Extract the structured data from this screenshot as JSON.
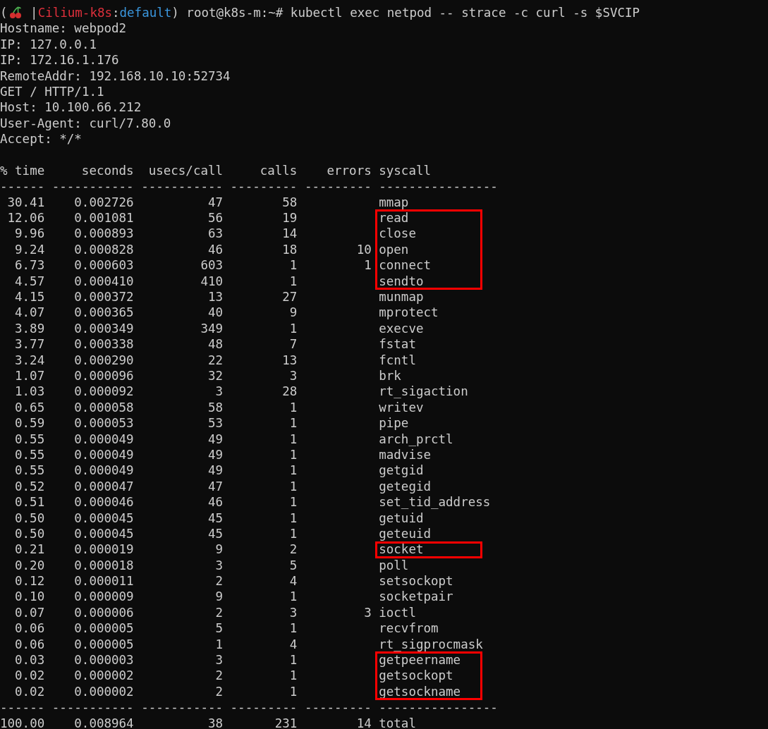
{
  "prompt": [
    {
      "kind": "plain",
      "text": "("
    },
    {
      "kind": "icon"
    },
    {
      "kind": "plain",
      "text": " |"
    },
    {
      "kind": "context",
      "text": "Cilium-k8s"
    },
    {
      "kind": "plain",
      "text": ":"
    },
    {
      "kind": "namespace",
      "text": "default"
    },
    {
      "kind": "plain",
      "text": ") root@k8s-m:~# kubectl exec netpod -- strace -c curl -s $SVCIP"
    }
  ],
  "output_lines": [
    "Hostname: webpod2",
    "IP: 127.0.0.1",
    "IP: 172.16.1.176",
    "RemoteAddr: 192.168.10.10:52734",
    "GET / HTTP/1.1",
    "Host: 10.100.66.212",
    "User-Agent: curl/7.80.0",
    "Accept: */*"
  ],
  "table": {
    "columns": [
      "% time",
      "seconds",
      "usecs/call",
      "calls",
      "errors",
      "syscall"
    ],
    "rule": [
      "------",
      "-----------",
      "-----------",
      "---------",
      "---------",
      "----------------"
    ],
    "rows": [
      {
        "cells": [
          "30.41",
          "0.002726",
          "47",
          "58",
          "",
          "mmap"
        ],
        "highlighted": false
      },
      {
        "cells": [
          "12.06",
          "0.001081",
          "56",
          "19",
          "",
          "read"
        ],
        "highlighted": true
      },
      {
        "cells": [
          "9.96",
          "0.000893",
          "63",
          "14",
          "",
          "close"
        ],
        "highlighted": true
      },
      {
        "cells": [
          "9.24",
          "0.000828",
          "46",
          "18",
          "10",
          "open"
        ],
        "highlighted": true
      },
      {
        "cells": [
          "6.73",
          "0.000603",
          "603",
          "1",
          "1",
          "connect"
        ],
        "highlighted": true
      },
      {
        "cells": [
          "4.57",
          "0.000410",
          "410",
          "1",
          "",
          "sendto"
        ],
        "highlighted": true
      },
      {
        "cells": [
          "4.15",
          "0.000372",
          "13",
          "27",
          "",
          "munmap"
        ],
        "highlighted": false
      },
      {
        "cells": [
          "4.07",
          "0.000365",
          "40",
          "9",
          "",
          "mprotect"
        ],
        "highlighted": false
      },
      {
        "cells": [
          "3.89",
          "0.000349",
          "349",
          "1",
          "",
          "execve"
        ],
        "highlighted": false
      },
      {
        "cells": [
          "3.77",
          "0.000338",
          "48",
          "7",
          "",
          "fstat"
        ],
        "highlighted": false
      },
      {
        "cells": [
          "3.24",
          "0.000290",
          "22",
          "13",
          "",
          "fcntl"
        ],
        "highlighted": false
      },
      {
        "cells": [
          "1.07",
          "0.000096",
          "32",
          "3",
          "",
          "brk"
        ],
        "highlighted": false
      },
      {
        "cells": [
          "1.03",
          "0.000092",
          "3",
          "28",
          "",
          "rt_sigaction"
        ],
        "highlighted": false
      },
      {
        "cells": [
          "0.65",
          "0.000058",
          "58",
          "1",
          "",
          "writev"
        ],
        "highlighted": false
      },
      {
        "cells": [
          "0.59",
          "0.000053",
          "53",
          "1",
          "",
          "pipe"
        ],
        "highlighted": false
      },
      {
        "cells": [
          "0.55",
          "0.000049",
          "49",
          "1",
          "",
          "arch_prctl"
        ],
        "highlighted": false
      },
      {
        "cells": [
          "0.55",
          "0.000049",
          "49",
          "1",
          "",
          "madvise"
        ],
        "highlighted": false
      },
      {
        "cells": [
          "0.55",
          "0.000049",
          "49",
          "1",
          "",
          "getgid"
        ],
        "highlighted": false
      },
      {
        "cells": [
          "0.52",
          "0.000047",
          "47",
          "1",
          "",
          "getegid"
        ],
        "highlighted": false
      },
      {
        "cells": [
          "0.51",
          "0.000046",
          "46",
          "1",
          "",
          "set_tid_address"
        ],
        "highlighted": false
      },
      {
        "cells": [
          "0.50",
          "0.000045",
          "45",
          "1",
          "",
          "getuid"
        ],
        "highlighted": false
      },
      {
        "cells": [
          "0.50",
          "0.000045",
          "45",
          "1",
          "",
          "geteuid"
        ],
        "highlighted": false
      },
      {
        "cells": [
          "0.21",
          "0.000019",
          "9",
          "2",
          "",
          "socket"
        ],
        "highlighted": true
      },
      {
        "cells": [
          "0.20",
          "0.000018",
          "3",
          "5",
          "",
          "poll"
        ],
        "highlighted": false
      },
      {
        "cells": [
          "0.12",
          "0.000011",
          "2",
          "4",
          "",
          "setsockopt"
        ],
        "highlighted": false
      },
      {
        "cells": [
          "0.10",
          "0.000009",
          "9",
          "1",
          "",
          "socketpair"
        ],
        "highlighted": false
      },
      {
        "cells": [
          "0.07",
          "0.000006",
          "2",
          "3",
          "3",
          "ioctl"
        ],
        "highlighted": false
      },
      {
        "cells": [
          "0.06",
          "0.000005",
          "5",
          "1",
          "",
          "recvfrom"
        ],
        "highlighted": false
      },
      {
        "cells": [
          "0.06",
          "0.000005",
          "1",
          "4",
          "",
          "rt_sigprocmask"
        ],
        "highlighted": false
      },
      {
        "cells": [
          "0.03",
          "0.000003",
          "3",
          "1",
          "",
          "getpeername"
        ],
        "highlighted": true
      },
      {
        "cells": [
          "0.02",
          "0.000002",
          "2",
          "1",
          "",
          "getsockopt"
        ],
        "highlighted": true
      },
      {
        "cells": [
          "0.02",
          "0.000002",
          "2",
          "1",
          "",
          "getsockname"
        ],
        "highlighted": true
      }
    ],
    "total": [
      "100.00",
      "0.008964",
      "38",
      "231",
      "14",
      "total"
    ]
  }
}
